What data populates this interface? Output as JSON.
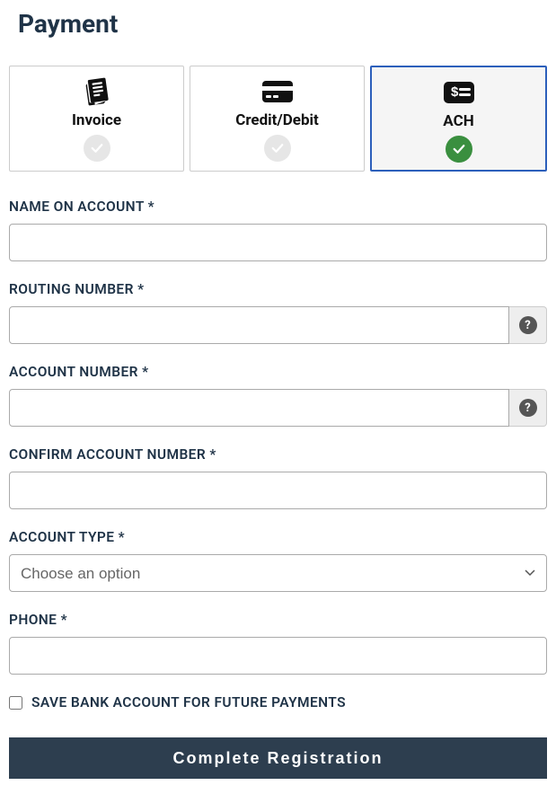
{
  "header": {
    "title": "Payment"
  },
  "paymentMethods": {
    "invoice": {
      "label": "Invoice",
      "selected": false
    },
    "creditDebit": {
      "label": "Credit/Debit",
      "selected": false
    },
    "ach": {
      "label": "ACH",
      "selected": true
    }
  },
  "form": {
    "nameOnAccount": {
      "label": "NAME ON ACCOUNT *",
      "value": ""
    },
    "routingNumber": {
      "label": "ROUTING NUMBER *",
      "value": ""
    },
    "accountNumber": {
      "label": "ACCOUNT NUMBER *",
      "value": ""
    },
    "confirmAccountNumber": {
      "label": "CONFIRM ACCOUNT NUMBER *",
      "value": ""
    },
    "accountType": {
      "label": "ACCOUNT TYPE *",
      "placeholder": "Choose an option",
      "value": ""
    },
    "phone": {
      "label": "PHONE *",
      "value": ""
    },
    "saveAccount": {
      "label": "SAVE BANK ACCOUNT FOR FUTURE PAYMENTS",
      "checked": false
    }
  },
  "actions": {
    "submitLabel": "Complete Registration"
  },
  "icons": {
    "helpGlyph": "?"
  }
}
